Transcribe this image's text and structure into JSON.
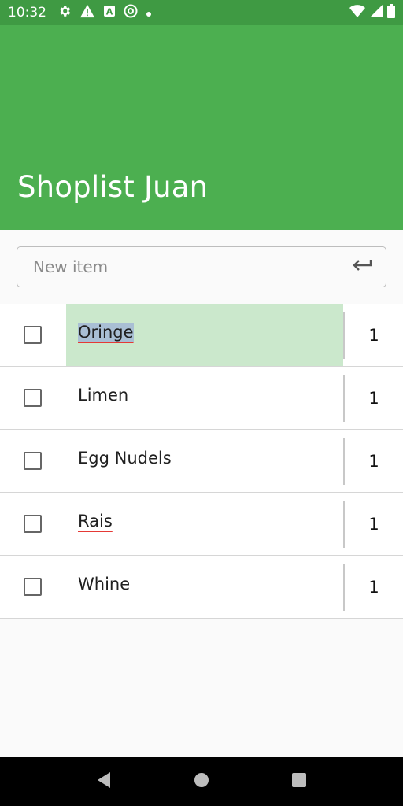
{
  "status_bar": {
    "time": "10:32",
    "left_icons": [
      "gear-icon",
      "warning-icon",
      "a-box-icon",
      "at-sign-icon",
      "dot-icon"
    ],
    "right_icons": [
      "wifi-icon",
      "signal-icon",
      "battery-icon"
    ]
  },
  "app_bar": {
    "title": "Shoplist Juan",
    "color": "#4caf50"
  },
  "new_item": {
    "placeholder": "New item",
    "value": "",
    "submit_icon": "enter-icon"
  },
  "items": [
    {
      "name": "Oringe",
      "qty": "1",
      "checked": false,
      "selected": true,
      "misspelled": true
    },
    {
      "name": "Limen",
      "qty": "1",
      "checked": false,
      "selected": false,
      "misspelled": false
    },
    {
      "name": "Egg Nudels",
      "qty": "1",
      "checked": false,
      "selected": false,
      "misspelled": false
    },
    {
      "name": "Rais",
      "qty": "1",
      "checked": false,
      "selected": false,
      "misspelled": true
    },
    {
      "name": "Whine",
      "qty": "1",
      "checked": false,
      "selected": false,
      "misspelled": false
    }
  ],
  "nav_bar": {
    "buttons": [
      "back-icon",
      "home-icon",
      "recents-icon"
    ]
  }
}
